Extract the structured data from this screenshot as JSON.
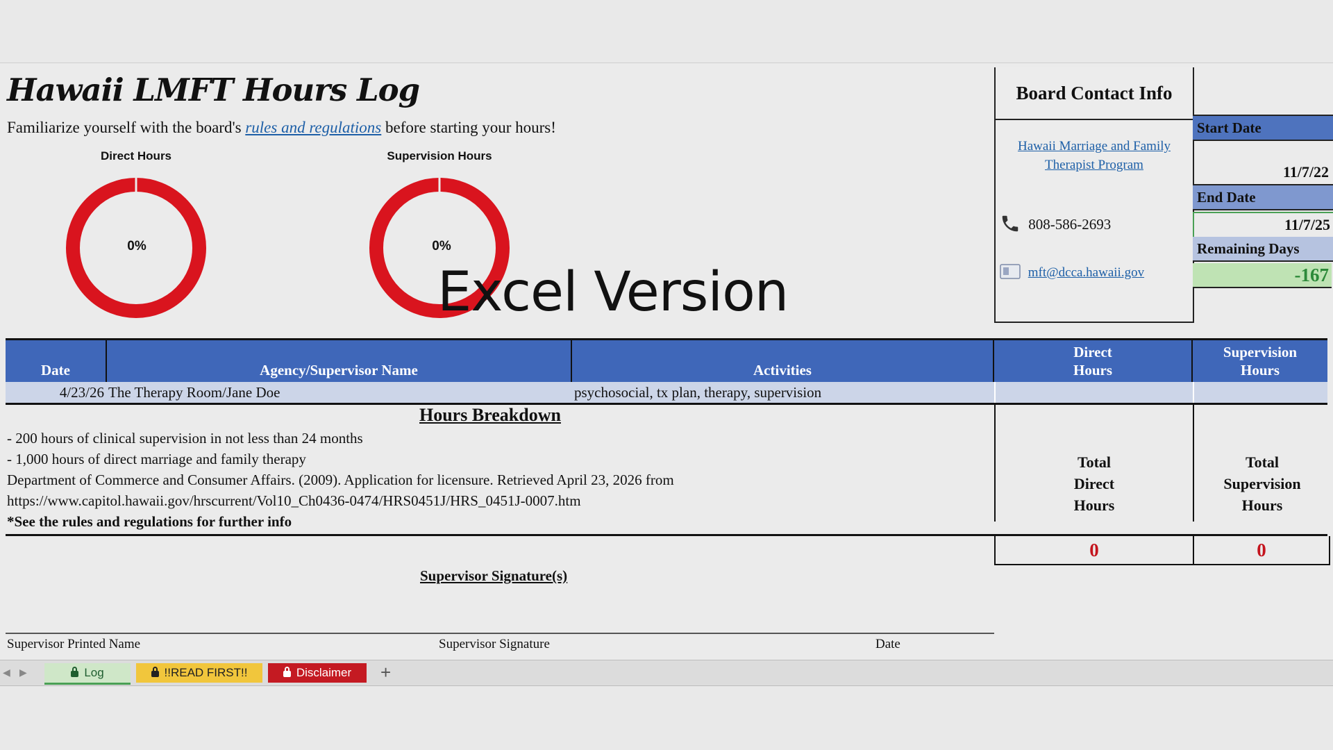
{
  "sheet": {
    "title": "Hawaii LMFT Hours Log",
    "intro_before": "Familiarize yourself with the board's",
    "intro_link": "rules and regulations",
    "intro_after": "before starting your hours!",
    "overlay_text": "Excel Version",
    "donuts": [
      {
        "label": "Direct Hours",
        "percent_text": "0%",
        "percent": 0
      },
      {
        "label": "Supervision Hours",
        "percent_text": "0%",
        "percent": 0
      }
    ]
  },
  "board": {
    "title": "Board Contact Info",
    "link": "Hawaii Marriage and Family Therapist Program",
    "phone": "808-586-2693",
    "email": "mft@dcca.hawaii.gov"
  },
  "dates": {
    "start_label": "Start Date",
    "start_value": "11/7/22",
    "end_label": "End Date",
    "end_value": "11/7/25",
    "remaining_label": "Remaining Days",
    "remaining_value": "-167"
  },
  "table": {
    "headers": {
      "date": "Date",
      "agency": "Agency/Supervisor Name",
      "activities": "Activities",
      "direct_l1": "Direct",
      "direct_l2": "Hours",
      "supervision_l1": "Supervision",
      "supervision_l2": "Hours"
    },
    "rows": [
      {
        "date": "4/23/26",
        "agency": "The Therapy Room/Jane Doe",
        "activities": "psychosocial, tx plan, therapy, supervision",
        "direct": "",
        "supervision": ""
      }
    ]
  },
  "breakdown": {
    "title": "Hours Breakdown",
    "lines": [
      "- 200 hours of clinical supervision in not less than 24 months",
      "- 1,000 hours of direct marriage and family therapy",
      "Department of Commerce and Consumer Affairs. (2009). Application for licensure. Retrieved April 23, 2026 from",
      "https://www.capitol.hawaii.gov/hrscurrent/Vol10_Ch0436-0474/HRS0451J/HRS_0451J-0007.htm",
      "*See the rules and regulations for further info"
    ]
  },
  "totals": {
    "direct_l1": "Total",
    "direct_l2": "Direct",
    "direct_l3": "Hours",
    "supervision_l1": "Total",
    "supervision_l2": "Supervision",
    "supervision_l3": "Hours",
    "direct_value": "0",
    "supervision_value": "0"
  },
  "signature": {
    "title": "Supervisor Signature(s)",
    "printed_name": "Supervisor Printed Name",
    "signature": "Supervisor Signature",
    "date": "Date"
  },
  "tabs": [
    {
      "label": "Log",
      "color": "#cfe7c8"
    },
    {
      "label": "!!READ FIRST!!",
      "color": "#f1c63c"
    },
    {
      "label": "Disclaimer",
      "color": "#c41a22"
    }
  ],
  "colors": {
    "header_blue": "#3f67b9",
    "donut_red": "#d9141e",
    "remaining_green": "#bfe3b4",
    "total_red": "#c4141d"
  }
}
